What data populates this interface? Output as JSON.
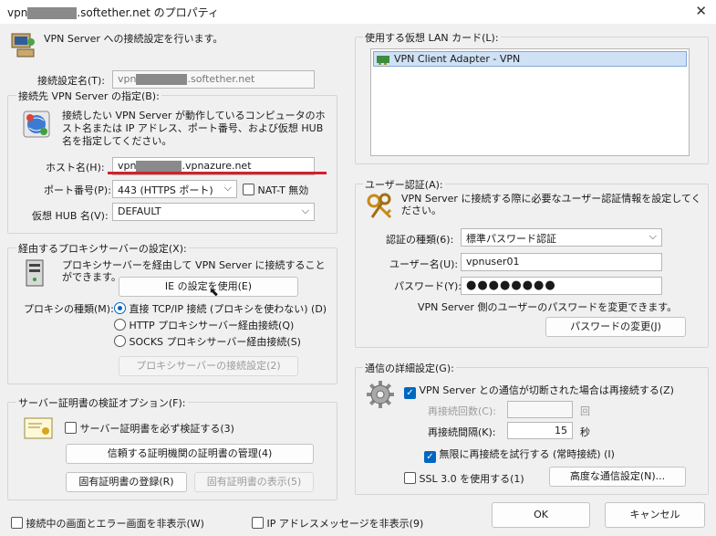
{
  "window": {
    "title_prefix": "vpn",
    "title_suffix": ".softether.net のプロパティ"
  },
  "header": {
    "text": "VPN Server への接続設定を行います。"
  },
  "conn_name": {
    "label": "接続設定名(T):",
    "value_prefix": "vpn",
    "value_suffix": ".softether.net"
  },
  "server_group": {
    "title": "接続先 VPN Server の指定(B):",
    "desc": "接続したい VPN Server が動作しているコンピュータのホスト名または IP アドレス、ポート番号、および仮想 HUB 名を指定してください。",
    "host_label": "ホスト名(H):",
    "host_prefix": "vpn",
    "host_suffix": ".vpnazure.net",
    "port_label": "ポート番号(P):",
    "port_value": "443 (HTTPS ポート)",
    "natt_label": "NAT-T 無効",
    "hub_label": "仮想 HUB 名(V):",
    "hub_value": "DEFAULT"
  },
  "proxy_group": {
    "title": "経由するプロキシサーバーの設定(X):",
    "desc": "プロキシサーバーを経由して VPN Server に接続することができます。",
    "ie_button": "IE の設定を使用(E)",
    "type_label": "プロキシの種類(M):",
    "options": [
      "直接 TCP/IP 接続 (プロキシを使わない) (D)",
      "HTTP プロキシサーバー経由接続(Q)",
      "SOCKS プロキシサーバー経由接続(S)"
    ],
    "settings_button": "プロキシサーバーの接続設定(2)"
  },
  "cert_group": {
    "title": "サーバー証明書の検証オプション(F):",
    "verify_label": "サーバー証明書を必ず検証する(3)",
    "manage_button": "信頼する証明機関の証明書の管理(4)",
    "register_button": "固有証明書の登録(R)",
    "show_button": "固有証明書の表示(5)"
  },
  "lan_group": {
    "title": "使用する仮想 LAN カード(L):",
    "items": [
      "VPN Client Adapter - VPN"
    ]
  },
  "auth_group": {
    "title": "ユーザー認証(A):",
    "desc": "VPN Server に接続する際に必要なユーザー認証情報を設定してください。",
    "type_label": "認証の種類(6):",
    "type_value": "標準パスワード認証",
    "user_label": "ユーザー名(U):",
    "user_value": "vpnuser01",
    "pass_label": "パスワード(Y):",
    "pass_value": "●●●●●●●●",
    "change_note": "VPN Server 側のユーザーのパスワードを変更できます。",
    "change_button": "パスワードの変更(J)"
  },
  "adv_group": {
    "title": "通信の詳細設定(G):",
    "reconnect_label": "VPN Server との通信が切断された場合は再接続する(Z)",
    "retry_count_label": "再接続回数(C):",
    "retry_count_unit": "回",
    "retry_interval_label": "再接続間隔(K):",
    "retry_interval_value": "15",
    "retry_interval_unit": "秒",
    "infinite_label": "無限に再接続を試行する (常時接続) (I)",
    "ssl3_label": "SSL 3.0 を使用する(1)",
    "advanced_button": "高度な通信設定(N)..."
  },
  "footer": {
    "hide_status_label": "接続中の画面とエラー画面を非表示(W)",
    "hide_ip_label": "IP アドレスメッセージを非表示(9)",
    "ok": "OK",
    "cancel": "キャンセル"
  },
  "colors": {
    "accent": "#0067c0",
    "underline": "#d4202a",
    "selection": "#cfe1f5"
  },
  "icons": [
    "computer-icon",
    "globe-network-icon",
    "server-tower-icon",
    "certificate-icon",
    "network-adapter-icon",
    "keys-icon",
    "gear-icon",
    "close-icon",
    "chevron-down-icon"
  ]
}
